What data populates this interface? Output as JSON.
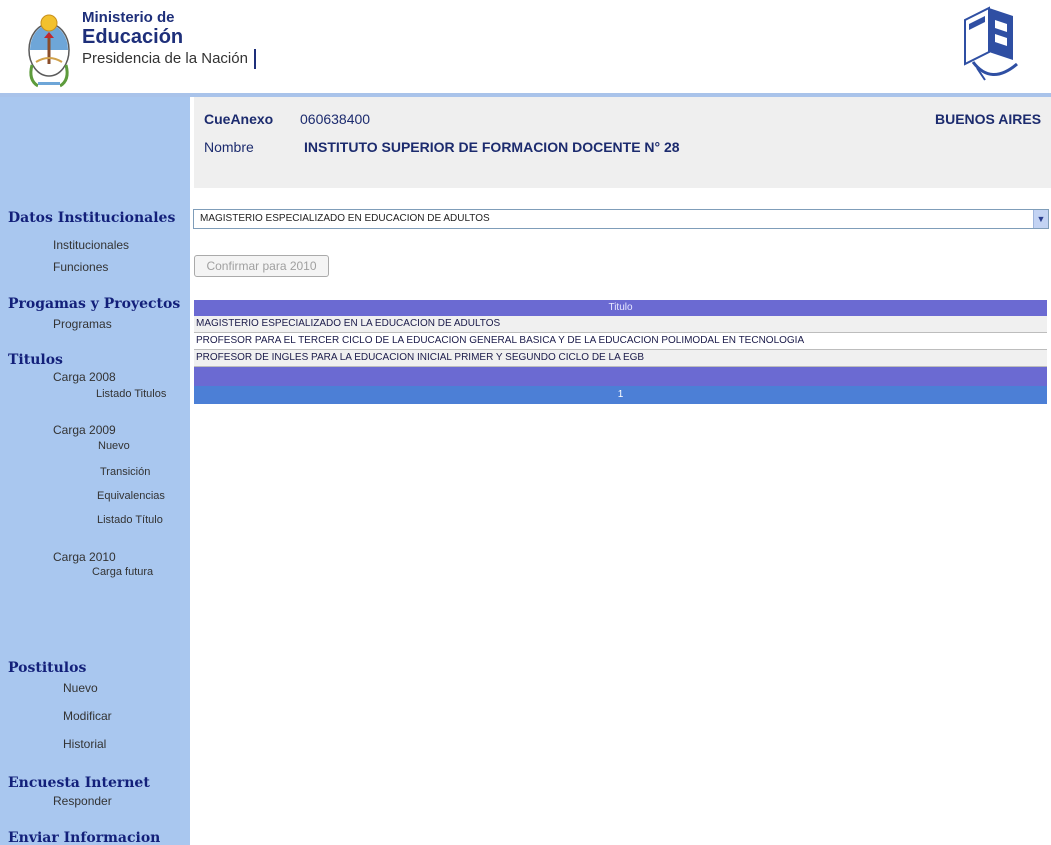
{
  "header": {
    "logo_line1": "Ministerio de",
    "logo_line2": "Educación",
    "logo_line3": "Presidencia de la Nación"
  },
  "institution": {
    "cue_label": "CueAnexo",
    "cue_value": "060638400",
    "province": "BUENOS AIRES",
    "name_label": "Nombre",
    "name_value": "INSTITUTO SUPERIOR DE FORMACION DOCENTE N° 28"
  },
  "sidebar": {
    "datos_title": "Datos Institucionales",
    "institucionales": "Institucionales",
    "funciones": "Funciones",
    "programas_title": "Progamas y Proyectos",
    "programas": "Programas",
    "titulos_title": "Titulos",
    "carga2008": "Carga 2008",
    "listado_titulos": "Listado Titulos",
    "carga2009": "Carga 2009",
    "nuevo": "Nuevo",
    "transicion": "Transición",
    "equivalencias": "Equivalencias",
    "listado_titulo": "Listado Título",
    "carga2010": "Carga 2010",
    "carga_futura": "Carga futura",
    "postitulos_title": "Postitulos",
    "post_nuevo": "Nuevo",
    "modificar": "Modificar",
    "historial": "Historial",
    "encuesta_title": "Encuesta Internet",
    "responder": "Responder",
    "enviar_title": "Enviar Informacion"
  },
  "select": {
    "value": "MAGISTERIO ESPECIALIZADO EN EDUCACION DE ADULTOS"
  },
  "confirm_button": "Confirmar para 2010",
  "table": {
    "header": "Titulo",
    "rows": [
      "MAGISTERIO ESPECIALIZADO EN LA EDUCACION DE ADULTOS",
      "PROFESOR PARA EL TERCER CICLO DE LA EDUCACION GENERAL BASICA Y DE LA EDUCACION POLIMODAL EN TECNOLOGIA",
      "PROFESOR DE INGLES PARA LA EDUCACION INICIAL PRIMER Y SEGUNDO CICLO DE LA EGB"
    ],
    "pager": "1"
  },
  "colors": {
    "sidebar_bg": "#a9c7ef",
    "table_header": "#6b6ad2",
    "pager_bar": "#4c7fd6",
    "brand_blue": "#1e2f7a"
  },
  "icons": {
    "emblem": "argentina-coat-of-arms-icon",
    "inet": "inet-logo-icon",
    "dropdown": "chevron-down-icon"
  }
}
